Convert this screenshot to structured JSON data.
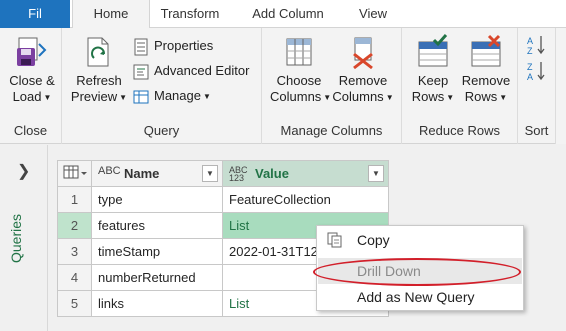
{
  "tabs": [
    "Fil",
    "Home",
    "Transform",
    "Add Column",
    "View"
  ],
  "ribbon": {
    "close": {
      "close_load": [
        "Close &",
        "Load"
      ],
      "label": "Close"
    },
    "query": {
      "refresh": [
        "Refresh",
        "Preview"
      ],
      "properties": "Properties",
      "advanced_editor": "Advanced Editor",
      "manage": "Manage",
      "label": "Query"
    },
    "manage_columns": {
      "choose": [
        "Choose",
        "Columns"
      ],
      "remove": [
        "Remove",
        "Columns"
      ],
      "label": "Manage Columns"
    },
    "reduce_rows": {
      "keep": [
        "Keep",
        "Rows"
      ],
      "remove": [
        "Remove",
        "Rows"
      ],
      "label": "Reduce Rows"
    },
    "sort": {
      "label": "Sort"
    }
  },
  "queries_pane": {
    "label": "Queries"
  },
  "grid": {
    "headers": {
      "name": "Name",
      "value": "Value",
      "name_type": "ABC",
      "value_type": [
        "ABC",
        "123"
      ]
    },
    "rows": [
      {
        "n": "1",
        "name": "type",
        "value": "FeatureCollection"
      },
      {
        "n": "2",
        "name": "features",
        "value": "List"
      },
      {
        "n": "3",
        "name": "timeStamp",
        "value": "2022-01-31T12"
      },
      {
        "n": "4",
        "name": "numberReturned",
        "value": ""
      },
      {
        "n": "5",
        "name": "links",
        "value": "List"
      }
    ]
  },
  "context_menu": {
    "copy": "Copy",
    "drill_down": "Drill Down",
    "add_query": "Add as New Query"
  },
  "colors": {
    "accent": "#217346",
    "file_tab": "#1e73be",
    "highlight": "#d21f2a"
  }
}
